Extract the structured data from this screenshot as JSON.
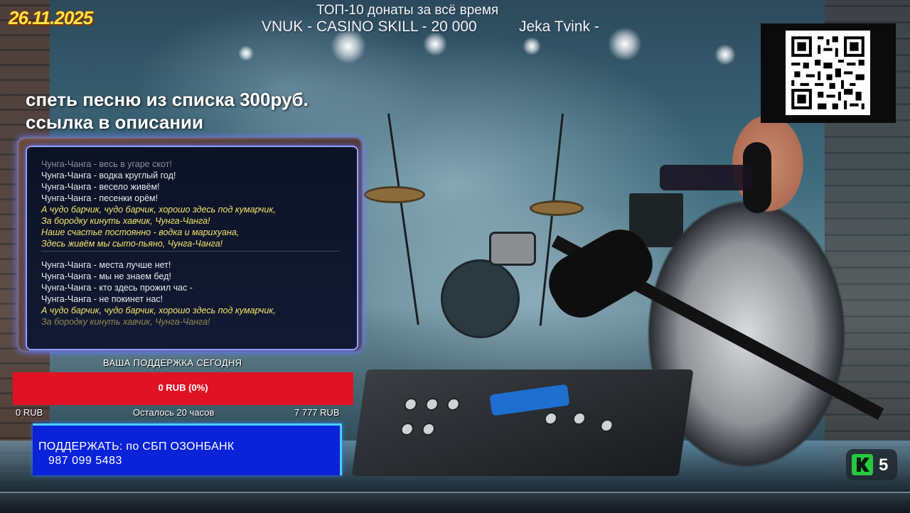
{
  "overlay": {
    "date": "26.11.2025",
    "top_title": "ТОП-10 донаты за всё время",
    "top_donor_1": "VNUK - CASINO SKILL - 20 000",
    "top_donor_2": "Jeka Tvink -",
    "song_promo_line1": "спеть песню из списка 300руб.",
    "song_promo_line2": "ссылка в описании"
  },
  "lyrics": {
    "block1": [
      "Чунга-Чанга - весь в угаре скот!",
      "Чунга-Чанга - водка круглый год!",
      "Чунга-Чанга - весело живём!",
      "Чунга-Чанга - песенки орём!",
      "А чудо барчик, чудо барчик, хорошо здесь под кумарчик,",
      "За бородку кинуть хавчик, Чунга-Чанга!",
      "Наше счастье постоянно - водка и марихуана,",
      "Здесь живём мы сыто-пьяно, Чунга-Чанга!"
    ],
    "block2": [
      "Чунга-Чанга - места лучше нет!",
      "Чунга-Чанга - мы не знаем бед!",
      "Чунга-Чанга - кто здесь прожил час -",
      "Чунга-Чанга - не покинет нас!",
      "А чудо барчик, чудо барчик, хорошо здесь под кумарчик,",
      "За бородку кинуть хавчик, Чунга-Чанга!"
    ]
  },
  "support": {
    "label": "ВАША ПОДДЕРЖКА СЕГОДНЯ",
    "bar_text": "0 RUB (0%)",
    "progress_percent": 0,
    "min": "0 RUB",
    "remaining": "Осталось 20 часов",
    "max": "7 777 RUB"
  },
  "donate": {
    "line1": "ПОДДЕРЖАТЬ: по СБП ОЗОНБАНК",
    "line2": "987 099 5483"
  },
  "badge": {
    "number": "5"
  },
  "colors": {
    "date": "#ffe14a",
    "support_bar": "#e01224",
    "donate_box": "#0a22d8",
    "lyrics_highlight": "#f3e46a",
    "badge_logo": "#27c93f"
  },
  "icons": {
    "qr": "qr-code-icon",
    "badge": "k-logo-icon"
  }
}
